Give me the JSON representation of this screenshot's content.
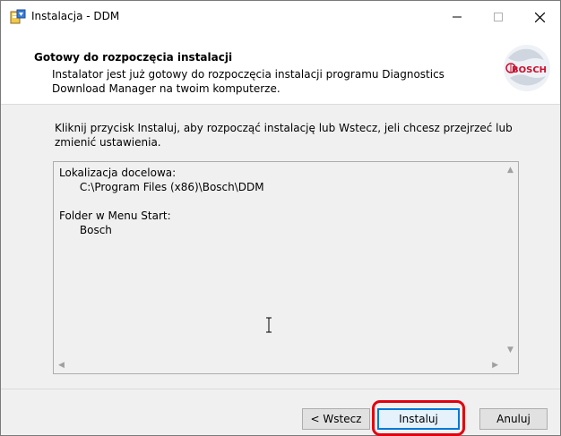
{
  "window": {
    "title": "Instalacja - DDM",
    "minimize_label": "—",
    "maximize_label": "☐",
    "close_label": "✕"
  },
  "header": {
    "title": "Gotowy do rozpoczęcia instalacji",
    "description": "Instalator jest już gotowy do rozpoczęcia instalacji programu Diagnostics Download Manager na twoim komputerze.",
    "logo_text": "BOSCH"
  },
  "body": {
    "instruction": "Kliknij przycisk Instaluj, aby rozpocząć instalację lub Wstecz, jeli chcesz przejrzeć lub zmienić ustawienia.",
    "memo_lines": "Lokalizacja docelowa:\n      C:\\Program Files (x86)\\Bosch\\DDM\n\nFolder w Menu Start:\n      Bosch"
  },
  "buttons": {
    "back": "< Wstecz",
    "install": "Instaluj",
    "cancel": "Anuluj"
  },
  "colors": {
    "highlight": "#e3000f",
    "accent": "#0078d7",
    "brand": "#c8102e"
  }
}
